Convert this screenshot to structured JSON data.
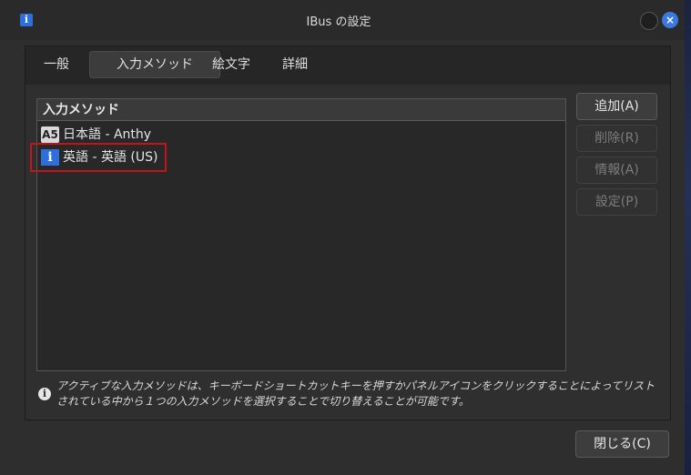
{
  "window": {
    "title": "IBus の設定",
    "app_icon": "info-icon",
    "close_icon": "close-icon"
  },
  "tabs": [
    {
      "label": "一般"
    },
    {
      "label": "入力メソッド"
    },
    {
      "label": "絵文字"
    },
    {
      "label": "詳細"
    }
  ],
  "input_methods": {
    "header": "入力メソッド",
    "items": [
      {
        "icon_text": "A5",
        "label": "日本語 - Anthy"
      },
      {
        "icon_text": "i",
        "label": "英語 - 英語 (US)"
      }
    ]
  },
  "buttons": {
    "add": "追加(A)",
    "remove": "削除(R)",
    "info": "情報(A)",
    "settings": "設定(P)",
    "close": "閉じる(C)"
  },
  "info_text": "アクティブな入力メソッドは、キーボードショートカットキーを押すかパネルアイコンをクリックすることによってリストされている中から１つの入力メソッドを選択することで切り替えることが可能です。",
  "colors": {
    "accent": "#2f6fdc",
    "highlight_border": "#c0161b"
  }
}
